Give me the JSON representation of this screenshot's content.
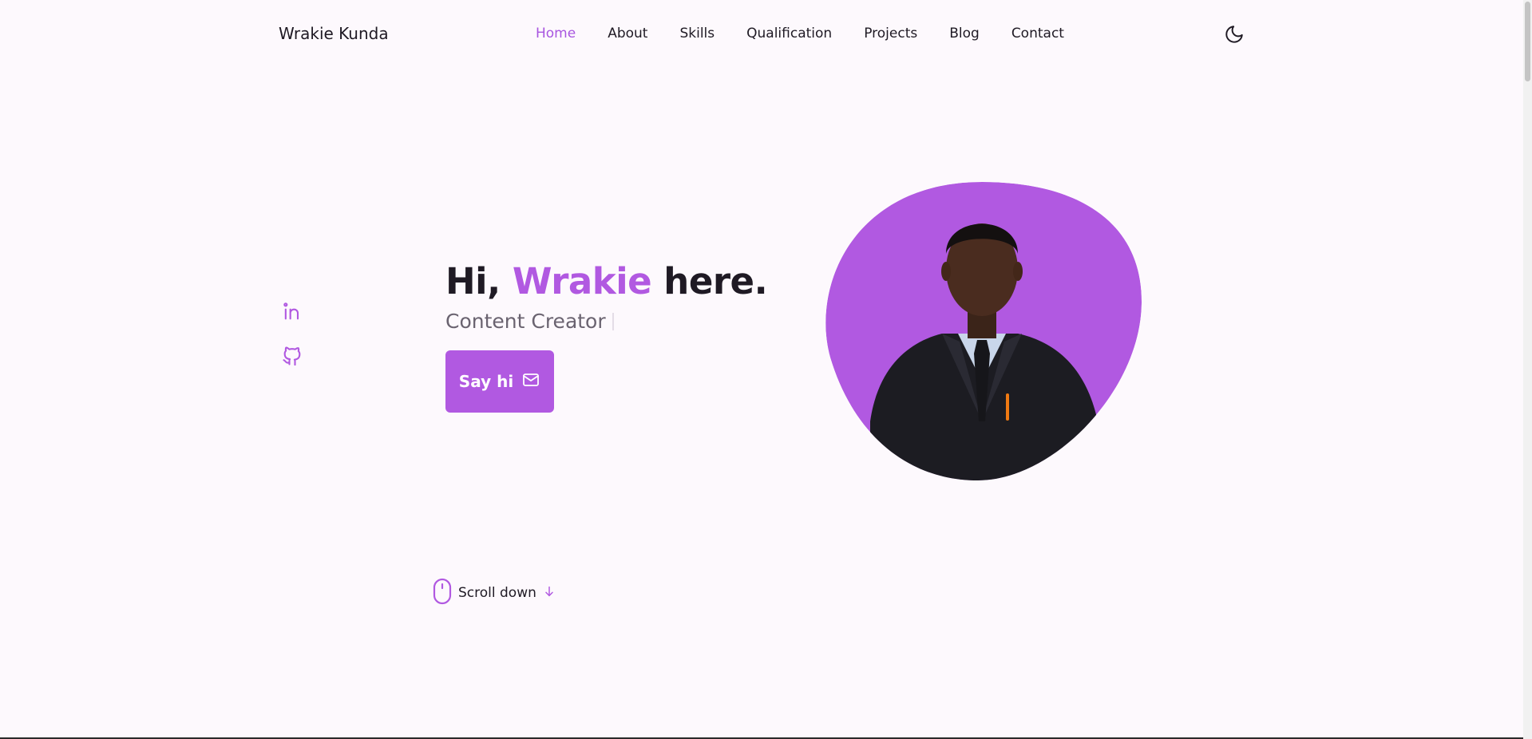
{
  "header": {
    "logo": "Wrakie Kunda",
    "nav": [
      "Home",
      "About",
      "Skills",
      "Qualification",
      "Projects",
      "Blog",
      "Contact"
    ],
    "active_nav": "Home",
    "theme_icon": "moon-icon"
  },
  "social": [
    {
      "icon": "linkedin-icon"
    },
    {
      "icon": "github-icon"
    }
  ],
  "hero": {
    "greeting_prefix": "Hi, ",
    "name": "Wrakie",
    "greeting_suffix": " here.",
    "subtitle": "Content Creator",
    "button_label": "Say hi",
    "button_icon": "mail-icon"
  },
  "scroll": {
    "label": "Scroll down",
    "icons": [
      "mouse-icon",
      "arrow-down-icon"
    ]
  },
  "colors": {
    "accent": "#b159e1",
    "background": "#fdf9fd",
    "text": "#1f1a24",
    "muted": "#6a6370"
  }
}
